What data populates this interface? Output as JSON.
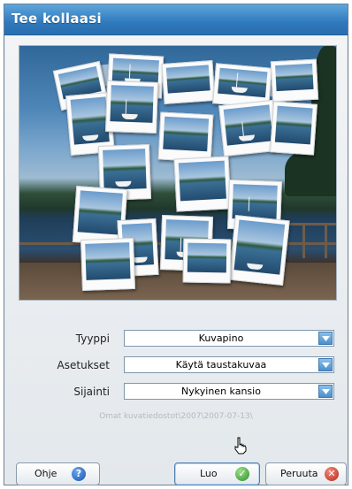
{
  "window": {
    "title": "Tee kollaasi"
  },
  "form": {
    "type": {
      "label": "Tyyppi",
      "value": "Kuvapino"
    },
    "settings": {
      "label": "Asetukset",
      "value": "Käytä taustakuvaa"
    },
    "location": {
      "label": "Sijainti",
      "value": "Nykyinen kansio"
    },
    "path": "Omat kuvatiedostot\\2007\\2007-07-13\\"
  },
  "buttons": {
    "help": "Ohje",
    "create": "Luo",
    "cancel": "Peruuta"
  },
  "icons": {
    "help": "question-icon",
    "create": "checkmark-icon",
    "cancel": "x-icon",
    "dropdown": "chevron-down-icon"
  },
  "colors": {
    "titlebar": "#2f79bd",
    "dropdown_button": "#4b8fcd"
  }
}
